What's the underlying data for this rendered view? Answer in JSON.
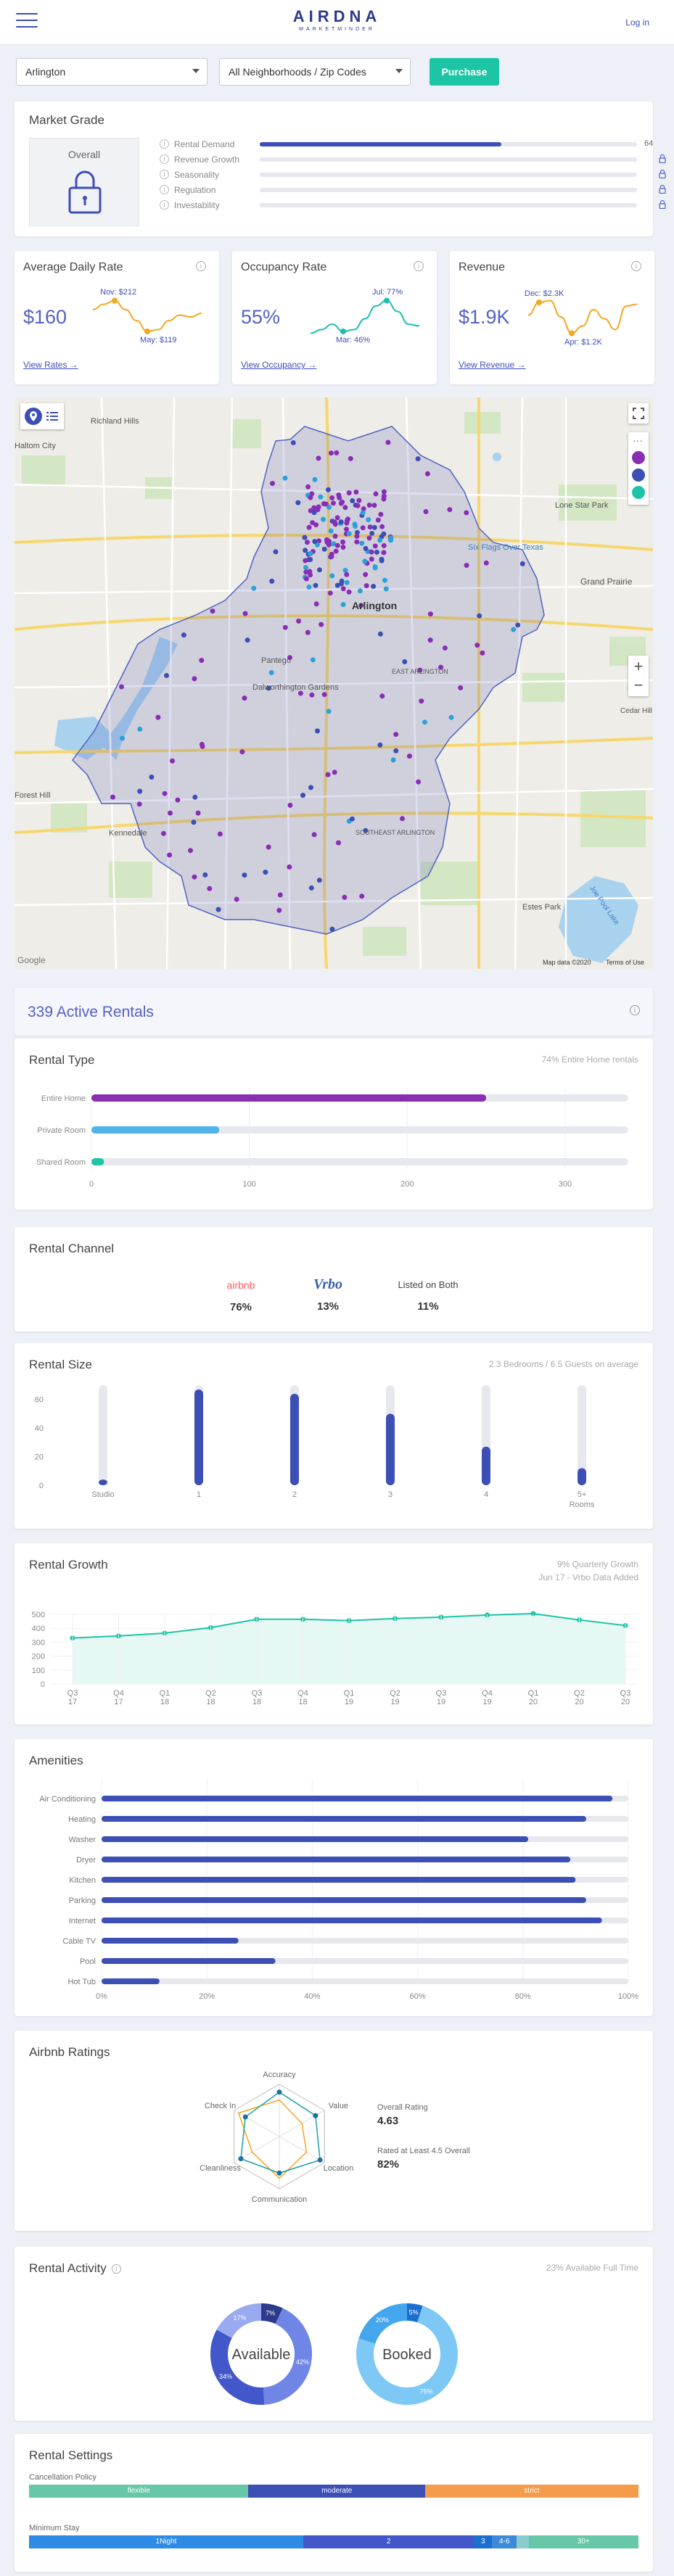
{
  "header": {
    "logo_main": "AIRDNA",
    "logo_sub": "MARKETMINDER",
    "login": "Log in"
  },
  "filters": {
    "city": "Arlington",
    "area": "All Neighborhoods / Zip Codes",
    "purchase": "Purchase"
  },
  "market_grade": {
    "title": "Market Grade",
    "overall_label": "Overall",
    "rows": [
      {
        "label": "Rental Demand",
        "value": "64",
        "fraction": 0.64,
        "locked": false
      },
      {
        "label": "Revenue Growth",
        "locked": true
      },
      {
        "label": "Seasonality",
        "locked": true
      },
      {
        "label": "Regulation",
        "locked": true
      },
      {
        "label": "Investability",
        "locked": true
      }
    ]
  },
  "kpis": [
    {
      "title": "Average Daily Rate",
      "value": "$160",
      "link": "View Rates →",
      "hi": "Nov: $212",
      "lo": "May: $119",
      "color": "#f5a623"
    },
    {
      "title": "Occupancy Rate",
      "value": "55%",
      "link": "View Occupancy →",
      "hi": "Jul: 77%",
      "lo": "Mar: 46%",
      "color": "#1cbfb0"
    },
    {
      "title": "Revenue",
      "value": "$1.9K",
      "link": "View Revenue →",
      "hi": "Dec: $2.3K",
      "lo": "Apr: $1.2K",
      "color": "#f5a623"
    }
  ],
  "map": {
    "labels": {
      "haltom": "Haltom City",
      "richland": "Richland Hills",
      "lonestar": "Lone Star Park",
      "grandprairie": "Grand Prairie",
      "sixflags": "Six Flags Over Texas",
      "arlington": "Arlington",
      "pantego": "Pantego",
      "dalworth": "Dalworthington Gardens",
      "eastarl": "EAST ARLINGTON",
      "forest": "Forest Hill",
      "kennedale": "Kennedale",
      "southeast": "SOUTHEAST ARLINGTON",
      "estes": "Estes Park",
      "joepool": "Joe Pool Lake",
      "cedar": "Cedar Hill State Park",
      "google": "Google",
      "mapdata": "Map data ©2020",
      "terms": "Terms of Use"
    }
  },
  "active_rentals": {
    "title": "339 Active Rentals"
  },
  "rental_type": {
    "title": "Rental Type",
    "note": "74% Entire Home rentals",
    "rows": [
      {
        "label": "Entire Home",
        "value": 250,
        "color": "#8a2db5"
      },
      {
        "label": "Private Room",
        "value": 81,
        "color": "#4fb4ea"
      },
      {
        "label": "Shared Room",
        "value": 8,
        "color": "#1cc5a5"
      }
    ],
    "ticks": [
      "0",
      "100",
      "200",
      "300"
    ],
    "max": 340
  },
  "rental_channel": {
    "title": "Rental Channel",
    "airbnb": "airbnb",
    "vrbo": "Vrbo",
    "both": "Listed on Both",
    "airbnb_pct": "76%",
    "vrbo_pct": "13%",
    "both_pct": "11%"
  },
  "rental_size": {
    "title": "Rental Size",
    "note": "2.3 Bedrooms / 6.5 Guests on average",
    "yticks": [
      "60",
      "40",
      "20",
      "0"
    ],
    "ymax": 70,
    "bars": [
      {
        "label": "Studio",
        "value": 4
      },
      {
        "label": "1",
        "value": 67
      },
      {
        "label": "2",
        "value": 64
      },
      {
        "label": "3",
        "value": 50
      },
      {
        "label": "4",
        "value": 27
      },
      {
        "label": "5+",
        "label2": "Rooms",
        "value": 12
      }
    ]
  },
  "rental_growth": {
    "title": "Rental Growth",
    "note": "9% Quarterly Growth",
    "note2": "Jun 17 - Vrbo Data Added",
    "yticks": [
      "500",
      "400",
      "300",
      "200",
      "100",
      "0"
    ],
    "ymax": 500,
    "quarters": [
      [
        "Q3",
        "17"
      ],
      [
        "Q4",
        "17"
      ],
      [
        "Q1",
        "18"
      ],
      [
        "Q2",
        "18"
      ],
      [
        "Q3",
        "18"
      ],
      [
        "Q4",
        "18"
      ],
      [
        "Q1",
        "19"
      ],
      [
        "Q2",
        "19"
      ],
      [
        "Q3",
        "19"
      ],
      [
        "Q4",
        "19"
      ],
      [
        "Q1",
        "20"
      ],
      [
        "Q2",
        "20"
      ],
      [
        "Q3",
        "20"
      ]
    ],
    "values": [
      330,
      345,
      365,
      405,
      465,
      465,
      455,
      470,
      480,
      495,
      505,
      460,
      420
    ]
  },
  "amenities": {
    "title": "Amenities",
    "rows": [
      {
        "label": "Air Conditioning",
        "value": 97
      },
      {
        "label": "Heating",
        "value": 92
      },
      {
        "label": "Washer",
        "value": 81
      },
      {
        "label": "Dryer",
        "value": 89
      },
      {
        "label": "Kitchen",
        "value": 90
      },
      {
        "label": "Parking",
        "value": 92
      },
      {
        "label": "Internet",
        "value": 95
      },
      {
        "label": "Cable TV",
        "value": 26
      },
      {
        "label": "Pool",
        "value": 33
      },
      {
        "label": "Hot Tub",
        "value": 11
      }
    ],
    "ticks": [
      "0%",
      "20%",
      "40%",
      "60%",
      "80%",
      "100%"
    ]
  },
  "ratings": {
    "title": "Airbnb Ratings",
    "axes": [
      "Accuracy",
      "Value",
      "Location",
      "Communication",
      "Cleanliness",
      "Check In"
    ],
    "overall_label": "Overall Rating",
    "overall_value": "4.63",
    "rated_label": "Rated at Least 4.5 Overall",
    "rated_value": "82%"
  },
  "activity": {
    "title": "Rental Activity",
    "note": "23% Available Full Time",
    "available": {
      "label": "Available",
      "segments": [
        {
          "v": 7,
          "t": "7%",
          "c": "#2c3a8c"
        },
        {
          "v": 42,
          "t": "42%",
          "c": "#6f86e6"
        },
        {
          "v": 34,
          "t": "34%",
          "c": "#4257c9"
        },
        {
          "v": 17,
          "t": "17%",
          "c": "#9aaaf0"
        }
      ]
    },
    "booked": {
      "label": "Booked",
      "segments": [
        {
          "v": 5,
          "t": "5%",
          "c": "#1a6fd1"
        },
        {
          "v": 75,
          "t": "75%",
          "c": "#7ec8f5"
        },
        {
          "v": 20,
          "t": "20%",
          "c": "#44a6ec"
        }
      ]
    }
  },
  "settings": {
    "title": "Rental Settings",
    "cancel_label": "Cancellation Policy",
    "cancel": [
      {
        "t": "flexible",
        "v": 36,
        "c": "#66c8a8"
      },
      {
        "t": "moderate",
        "v": 29,
        "c": "#3c4fb5"
      },
      {
        "t": "strict",
        "v": 35,
        "c": "#f59b4c"
      }
    ],
    "stay_label": "Minimum Stay",
    "stay": [
      {
        "t": "1Night",
        "v": 45,
        "c": "#2d8be6"
      },
      {
        "t": "2",
        "v": 28,
        "c": "#4257c9"
      },
      {
        "t": "3",
        "v": 3,
        "c": "#1a6fd1"
      },
      {
        "t": "4-6",
        "v": 4,
        "c": "#3c8ad8"
      },
      {
        "t": "",
        "v": 2,
        "c": "#88cccc"
      },
      {
        "t": "30+",
        "v": 18,
        "c": "#66c8a8"
      }
    ]
  }
}
